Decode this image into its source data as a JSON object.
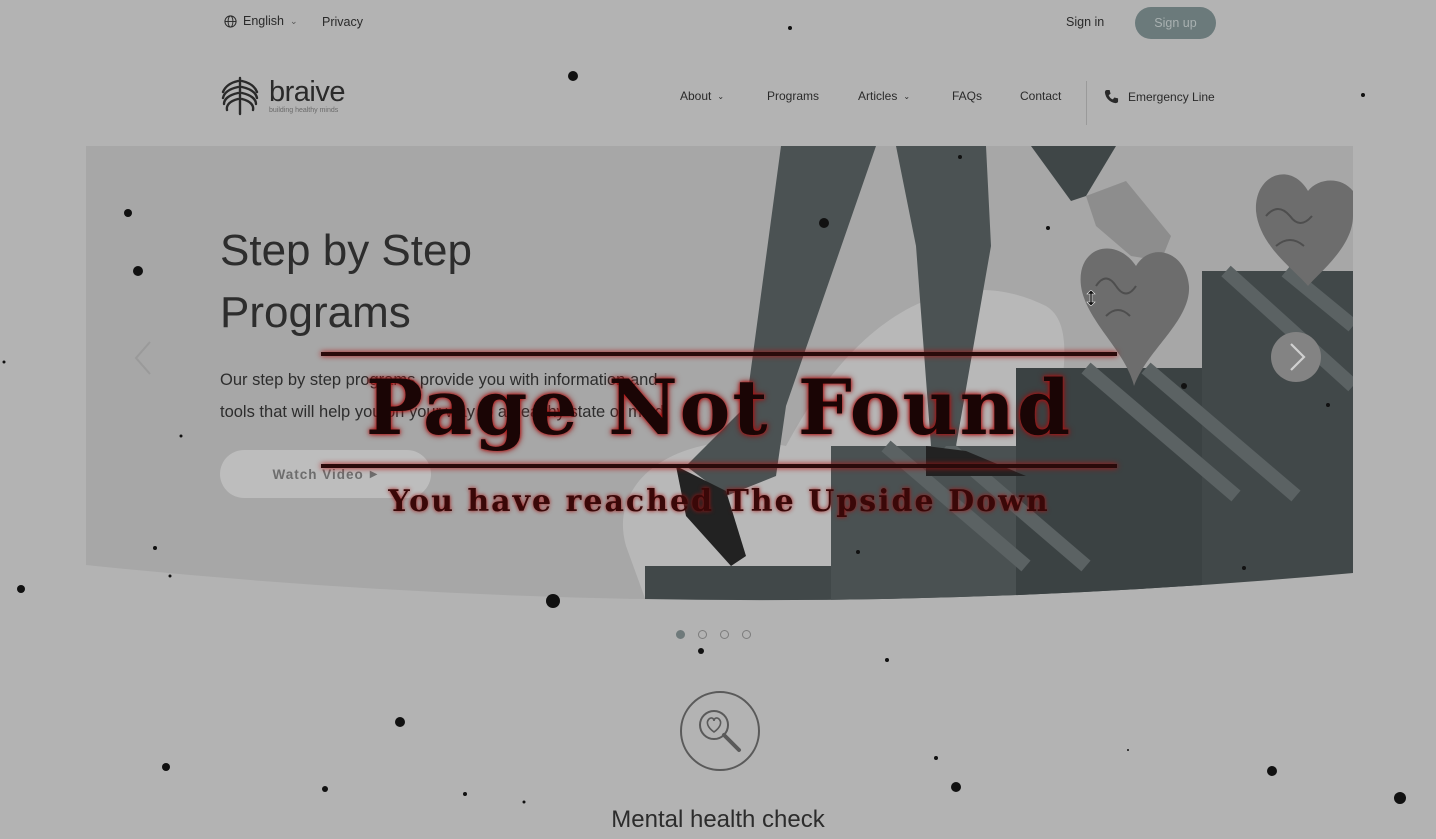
{
  "topbar": {
    "language": "English",
    "privacy": "Privacy",
    "sign_in": "Sign in",
    "sign_up": "Sign up"
  },
  "header": {
    "logo_name": "braive",
    "logo_tagline": "building healthy minds",
    "nav": [
      {
        "label": "About",
        "has_dropdown": true
      },
      {
        "label": "Programs",
        "has_dropdown": false
      },
      {
        "label": "Articles",
        "has_dropdown": true
      },
      {
        "label": "FAQs",
        "has_dropdown": false
      },
      {
        "label": "Contact",
        "has_dropdown": false
      }
    ],
    "emergency": "Emergency Line"
  },
  "hero": {
    "title_line1": "Step by Step",
    "title_line2": "Programs",
    "text_line1": "Our step by step programs provide you with information and",
    "text_line2": "tools that will help you on your way to a healthy state of mind.",
    "watch_label": "Watch Video",
    "slide_count": 4,
    "active_slide": 1
  },
  "section": {
    "title": "Mental health check"
  },
  "overlay": {
    "title": "Page Not Found",
    "subtitle": "You have reached The Upside Down"
  },
  "icons": {
    "globe": "globe-icon",
    "phone": "phone-icon",
    "prev": "chevron-left-icon",
    "next": "chevron-right-icon",
    "health_check": "heart-magnifier-icon"
  },
  "colors": {
    "page_bg": "#b3b3b3",
    "accent": "#6b7a7b",
    "overlay_glow": "#c41414"
  }
}
